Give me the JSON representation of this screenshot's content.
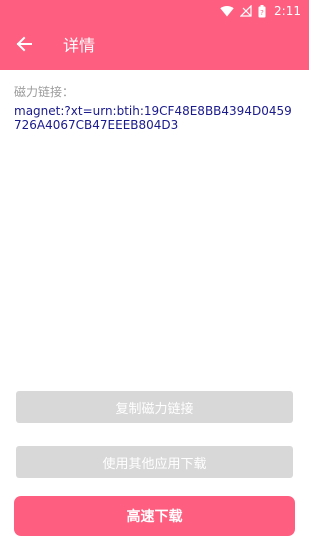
{
  "status_bar": {
    "time": "2:11",
    "icons": [
      "wifi-icon",
      "no-signal-icon",
      "battery-icon"
    ]
  },
  "app_bar": {
    "title": "详情",
    "back_icon": "arrow-left-icon"
  },
  "content": {
    "magnet_label": "磁力链接：",
    "magnet_link": "magnet:?xt=urn:btih:19CF48E8BB4394D0459726A4067CB47EEEB804D3"
  },
  "buttons": {
    "copy_label": "复制磁力链接",
    "other_app_label": "使用其他应用下载",
    "fast_download_label": "高速下载"
  },
  "colors": {
    "accent": "#fe5f80",
    "disabled": "#d8d8d8",
    "link_text": "#1a1a8c",
    "label_text": "#9b9b9b"
  }
}
